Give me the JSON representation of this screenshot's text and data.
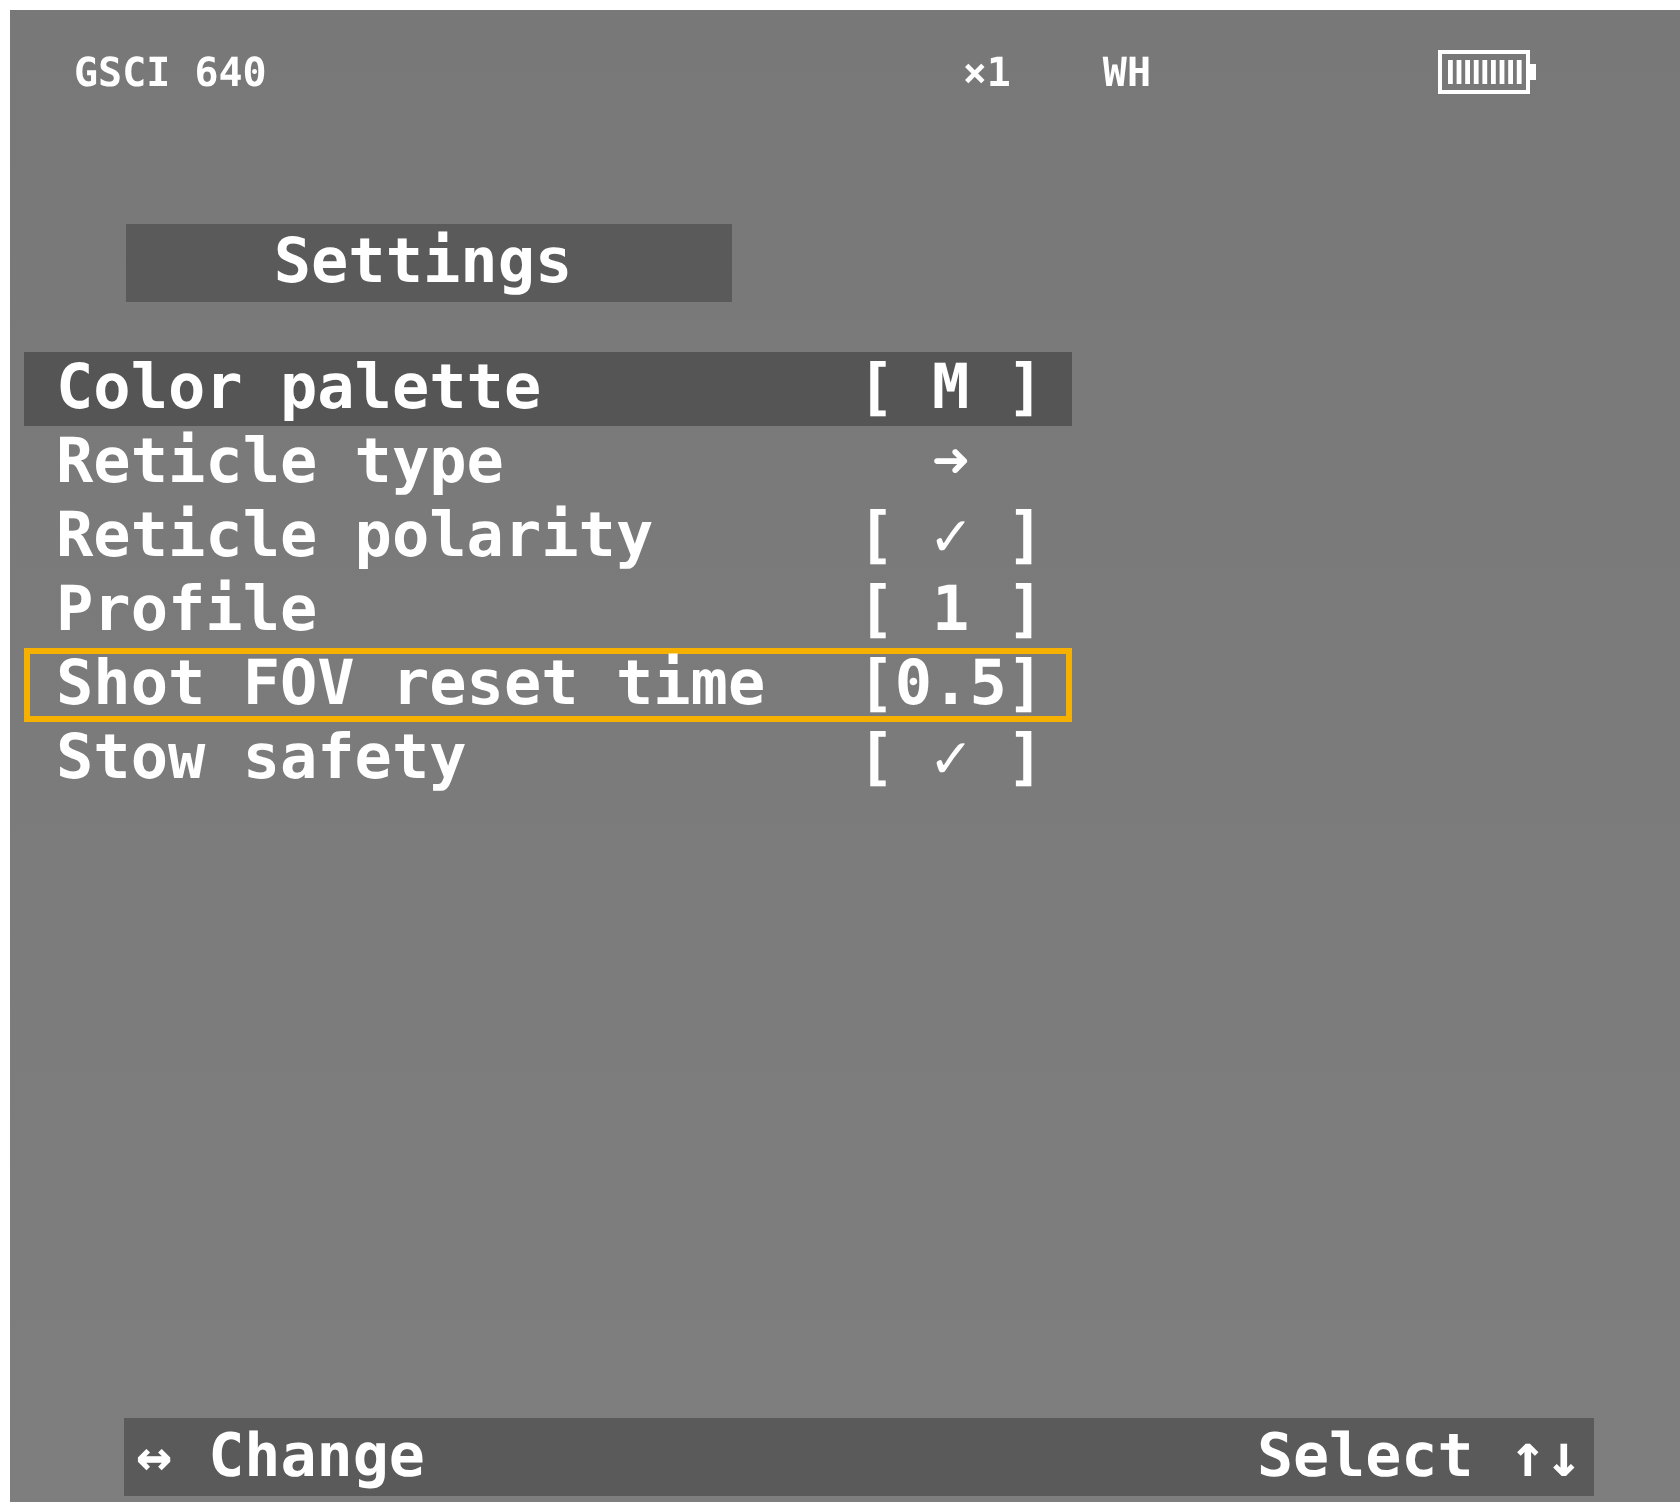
{
  "status_bar": {
    "device": "GSCI 640",
    "zoom": "×1",
    "palette": "WH"
  },
  "menu": {
    "title": "Settings",
    "items": [
      {
        "label": "Color palette",
        "value": "[ M ]",
        "selected": true,
        "outlined": false
      },
      {
        "label": "Reticle type",
        "value": "➜",
        "selected": false,
        "outlined": false
      },
      {
        "label": "Reticle polarity",
        "value": "[ ✓ ]",
        "selected": false,
        "outlined": false
      },
      {
        "label": "Profile",
        "value": "[ 1 ]",
        "selected": false,
        "outlined": false
      },
      {
        "label": "Shot FOV reset time",
        "value": "[0.5]",
        "selected": false,
        "outlined": true
      },
      {
        "label": "Stow safety",
        "value": "[ ✓ ]",
        "selected": false,
        "outlined": false
      }
    ]
  },
  "footer": {
    "left_icon": "↔",
    "left": "Change",
    "right": "Select",
    "right_icon": "↑↓"
  }
}
